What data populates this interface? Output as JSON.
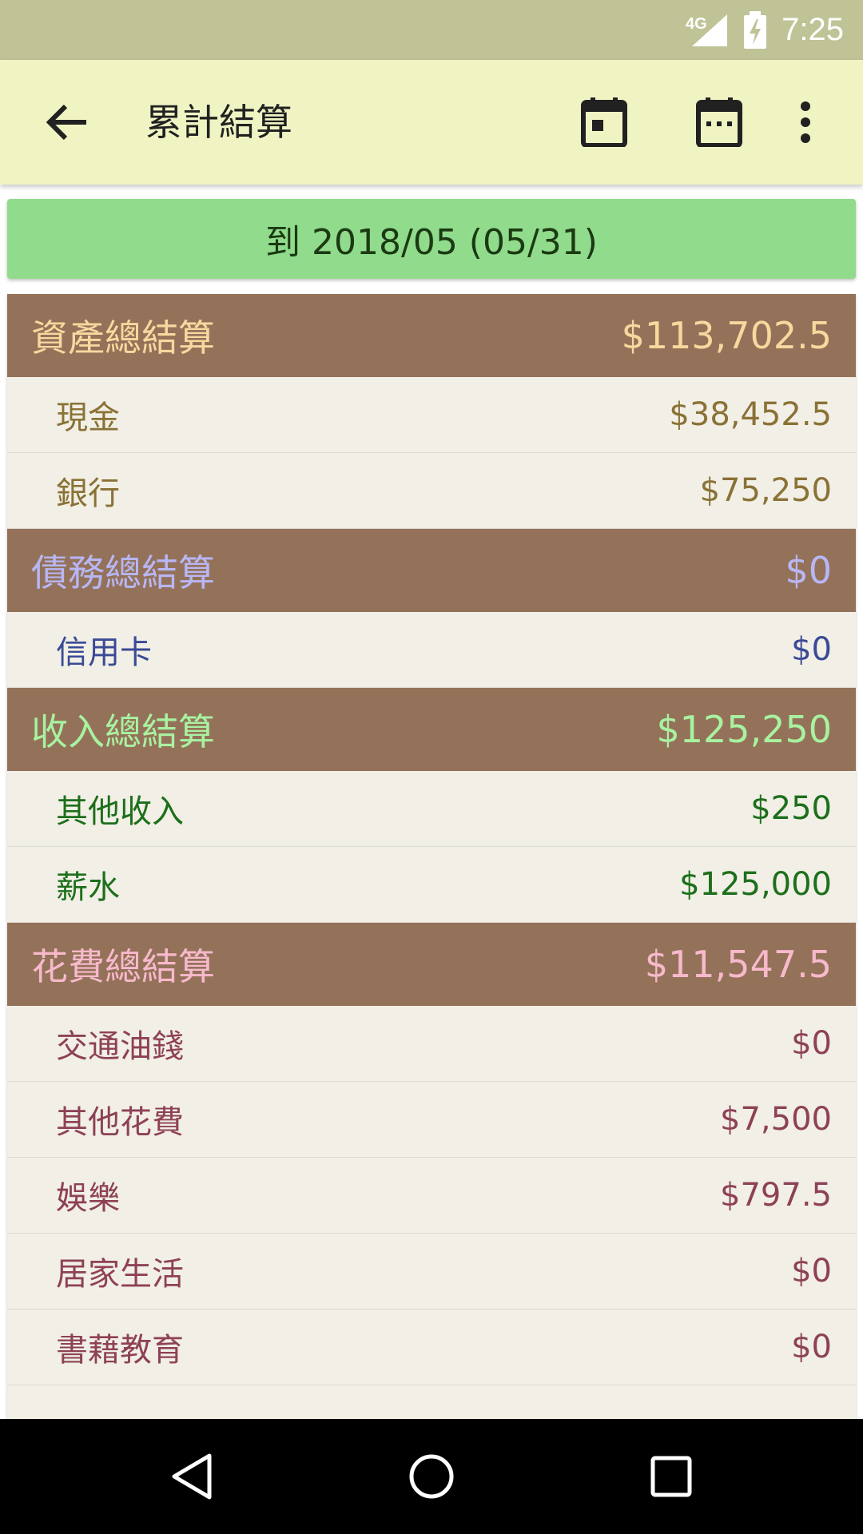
{
  "status_bar": {
    "network": "4G",
    "signal_icon": "cell-signal-icon",
    "battery_icon": "battery-charging-icon",
    "time": "7:25"
  },
  "app_bar": {
    "back_icon": "arrow-back-icon",
    "title": "累計結算",
    "actions": [
      "calendar-today-icon",
      "calendar-month-icon",
      "more-vert-icon"
    ]
  },
  "date_bar": {
    "label": "到 2018/05 (05/31)"
  },
  "colors": {
    "header_bg": "#94725A",
    "asset": "#F8D89E",
    "asset_item": "#8A7236",
    "debt": "#B8B6F5",
    "debt_item": "#3A4A96",
    "income": "#A8F2A0",
    "income_item": "#1D6F1B",
    "expense": "#F7B9CC",
    "expense_item": "#8E4156"
  },
  "groups": [
    {
      "title": "資產總結算",
      "total": "$113,702.5",
      "items": [
        {
          "name": "現金",
          "amount": "$38,452.5"
        },
        {
          "name": "銀行",
          "amount": "$75,250"
        }
      ]
    },
    {
      "title": "債務總結算",
      "total": "$0",
      "items": [
        {
          "name": "信用卡",
          "amount": "$0"
        }
      ]
    },
    {
      "title": "收入總結算",
      "total": "$125,250",
      "items": [
        {
          "name": "其他收入",
          "amount": "$250"
        },
        {
          "name": "薪水",
          "amount": "$125,000"
        }
      ]
    },
    {
      "title": "花費總結算",
      "total": "$11,547.5",
      "items": [
        {
          "name": "交通油錢",
          "amount": "$0"
        },
        {
          "name": "其他花費",
          "amount": "$7,500"
        },
        {
          "name": "娛樂",
          "amount": "$797.5"
        },
        {
          "name": "居家生活",
          "amount": "$0"
        },
        {
          "name": "書藉教育",
          "amount": "$0"
        }
      ]
    }
  ],
  "nav_bar": [
    "nav-back-icon",
    "nav-home-icon",
    "nav-recents-icon"
  ]
}
